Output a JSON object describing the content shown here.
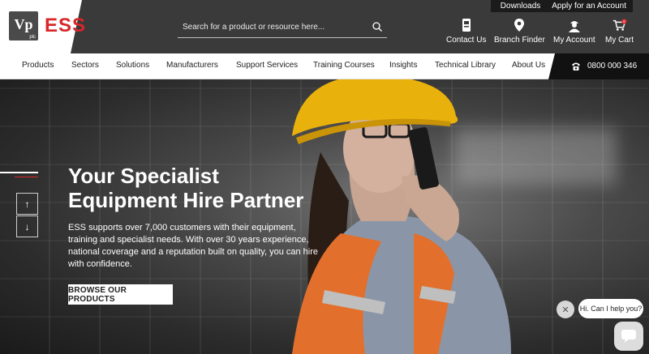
{
  "brand": {
    "vp": "Vp",
    "vp_sub": "plc",
    "ess": "ESS"
  },
  "topbar": {
    "links": [
      "Downloads",
      "Apply for an Account"
    ]
  },
  "search": {
    "placeholder": "Search for a product or resource here..."
  },
  "header_icons": [
    {
      "label": "Contact Us",
      "icon": "phone-icon"
    },
    {
      "label": "Branch Finder",
      "icon": "location-pin-icon"
    },
    {
      "label": "My Account",
      "icon": "user-icon"
    },
    {
      "label": "My Cart",
      "icon": "cart-icon",
      "badge": "0"
    }
  ],
  "nav": {
    "items": [
      "Products",
      "Sectors",
      "Solutions",
      "Manufacturers",
      "Support Services",
      "Training Courses",
      "Insights",
      "Technical Library",
      "About Us"
    ],
    "phone": "0800 000 346"
  },
  "hero": {
    "title": "Your Specialist Equipment Hire Partner",
    "body": "ESS supports over 7,000 customers with their equipment, training and specialist needs. With over 30 years experience, national coverage and a reputation built on quality, you can hire with confidence.",
    "cta": "BROWSE OUR PRODUCTS",
    "up_arrow": "↑",
    "down_arrow": "↓"
  },
  "chat": {
    "greeting": "Hi. Can I help you?",
    "close": "✕"
  },
  "colors": {
    "accent": "#d9262b",
    "header_dark": "#3a3a3a"
  }
}
